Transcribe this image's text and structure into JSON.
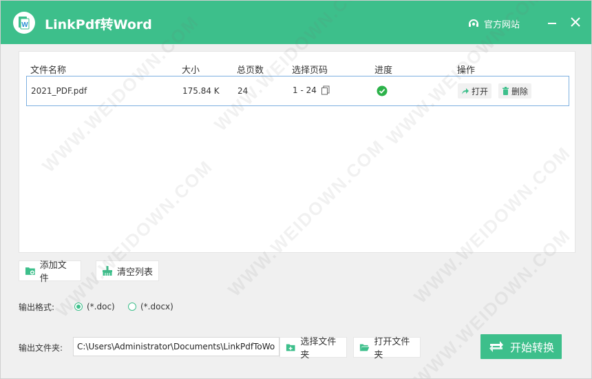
{
  "app": {
    "title": "LinkPdf转Word",
    "official_site_label": "官方网站",
    "brand_color": "#3dbf8b",
    "logo_letter": "W"
  },
  "table": {
    "headers": [
      "文件名称",
      "大小",
      "总页数",
      "选择页码",
      "进度",
      "操作"
    ],
    "rows": [
      {
        "name": "2021_PDF.pdf",
        "size": "175.84 K",
        "pages": "24",
        "page_range": "1 - 24",
        "progress": "complete",
        "open_label": "打开",
        "delete_label": "删除"
      }
    ]
  },
  "toolbar": {
    "add_file_label": "添加文件",
    "clear_list_label": "清空列表"
  },
  "output": {
    "format_label": "输出格式:",
    "formats": [
      {
        "label": "(*.doc)",
        "selected": true
      },
      {
        "label": "(*.docx)",
        "selected": false
      }
    ],
    "folder_label": "输出文件夹:",
    "folder_path": "C:\\Users\\Administrator\\Documents\\LinkPdfToWord",
    "choose_folder_label": "选择文件夹",
    "open_folder_label": "打开文件夹",
    "start_label": "开始转换"
  },
  "watermark_text": "WWW.WEIDOWN.COM"
}
